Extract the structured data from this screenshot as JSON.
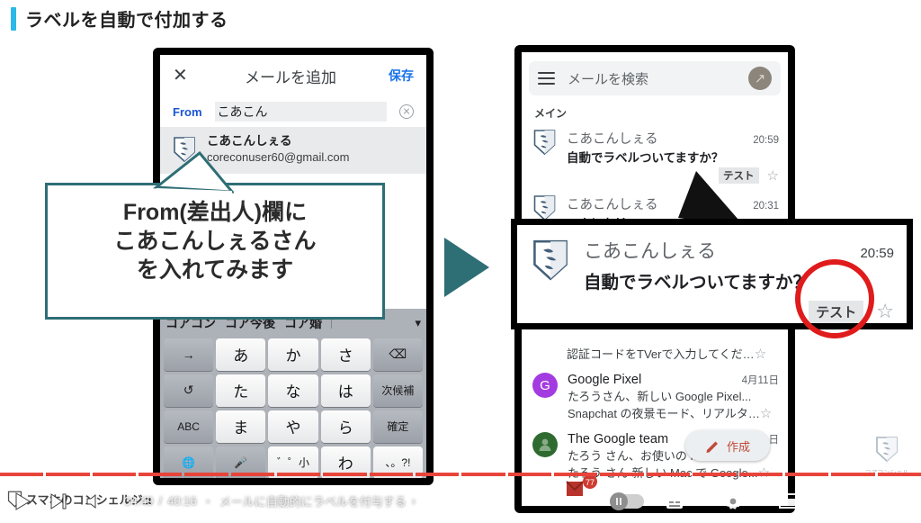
{
  "slide": {
    "title": "ラベルを自動で付加する",
    "accent_color": "#2bb9e8"
  },
  "callout_left": {
    "line1": "From(差出人)欄に",
    "line2": "こあこんしぇるさん",
    "line3": "を入れてみます",
    "border_color": "#2e6e75"
  },
  "phone_left": {
    "header": {
      "close_icon": "close-icon",
      "title": "メールを追加",
      "save_label": "保存",
      "save_color": "#1a73e8"
    },
    "from_field": {
      "label": "From",
      "value": "こあこん",
      "clear_icon": "clear-circle-icon"
    },
    "suggestion": {
      "name": "こあこんしぇる",
      "email": "coreconuser60@gmail.com",
      "avatar_icon": "koacon-shield-avatar"
    },
    "keyboard": {
      "candidates": [
        "コアコン",
        "コア今後",
        "コア婚"
      ],
      "expand_icon": "chevron-down-icon",
      "rows": [
        [
          {
            "label": "→",
            "type": "fn",
            "name": "cursor-right-key"
          },
          {
            "label": "あ",
            "type": "char",
            "name": "key-a"
          },
          {
            "label": "か",
            "type": "char",
            "name": "key-ka"
          },
          {
            "label": "さ",
            "type": "char",
            "name": "key-sa"
          },
          {
            "label": "⌫",
            "type": "fn",
            "name": "backspace-key"
          }
        ],
        [
          {
            "label": "↺",
            "type": "fn",
            "name": "undo-key"
          },
          {
            "label": "た",
            "type": "char",
            "name": "key-ta"
          },
          {
            "label": "な",
            "type": "char",
            "name": "key-na"
          },
          {
            "label": "は",
            "type": "char",
            "name": "key-ha"
          },
          {
            "label": "次候補",
            "type": "fn",
            "name": "next-candidate-key"
          }
        ],
        [
          {
            "label": "ABC",
            "type": "fn",
            "name": "abc-key"
          },
          {
            "label": "ま",
            "type": "char",
            "name": "key-ma"
          },
          {
            "label": "や",
            "type": "char",
            "name": "key-ya"
          },
          {
            "label": "ら",
            "type": "char",
            "name": "key-ra"
          },
          {
            "label": "確定",
            "type": "fn",
            "name": "confirm-key"
          }
        ],
        [
          {
            "label": "🌐",
            "type": "fn",
            "name": "globe-key"
          },
          {
            "label": "🎤",
            "type": "fn",
            "name": "mic-key"
          },
          {
            "label": "゛゜小",
            "type": "char",
            "name": "dakuten-key"
          },
          {
            "label": "わ",
            "type": "char",
            "name": "key-wa"
          },
          {
            "label": "、。?!",
            "type": "char",
            "name": "punctuation-key"
          }
        ]
      ]
    }
  },
  "phone_right": {
    "search": {
      "menu_icon": "hamburger-menu-icon",
      "placeholder": "メールを検索",
      "avatar_icon": "account-avatar"
    },
    "section_label": "メイン",
    "emails": [
      {
        "avatar_type": "shield",
        "sender": "こあこんしぇる",
        "time": "20:59",
        "subject": "自動でラベルついてますか？",
        "snippet": "",
        "label_chip": "テスト",
        "star_icon": "star-outline-icon"
      },
      {
        "avatar_type": "shield",
        "sender": "こあこんしぇる",
        "time": "20:31",
        "subject": "こんにちは",
        "snippet": "",
        "label_chip": "",
        "star_icon": "star-outline-icon"
      },
      {
        "avatar_type": "none",
        "sender": "",
        "time": "",
        "subject": "",
        "snippet": "認証コードをTVerで入力してくだ…",
        "label_chip": "",
        "star_icon": "star-outline-icon"
      },
      {
        "avatar_type": "letter",
        "avatar_letter": "G",
        "avatar_color": "#a33ce0",
        "sender": "Google Pixel",
        "time": "4月11日",
        "subject": "たろうさん、新しい Google Pixel...",
        "snippet": "Snapchat の夜景モード、リアルタ…",
        "label_chip": "",
        "star_icon": "star-outline-icon"
      },
      {
        "avatar_type": "person",
        "avatar_color": "#2f6b30",
        "sender": "The Google team",
        "time": "日",
        "subject": "たろう さん、お使いの M...",
        "snippet": "たろう さん 新しい Mac で Google...",
        "label_chip": "",
        "star_icon": "star-outline-icon"
      }
    ],
    "compose_fab": {
      "icon": "pencil-icon",
      "label": "作成"
    },
    "mail_badge": {
      "icon": "mail-icon",
      "count": "77"
    }
  },
  "zoom_callout": {
    "sender": "こあこんしぇる",
    "time": "20:59",
    "subject": "自動でラベルついてますか？",
    "label_chip": "テスト",
    "star_icon": "star-outline-icon",
    "highlight_color": "#e01b1b",
    "avatar_icon": "koacon-shield-avatar"
  },
  "arrow": {
    "name": "transition-arrow",
    "color": "#2e6e75"
  },
  "watermark": {
    "logo_text": "コアコンシェル",
    "channel": "スマホのコンシェルジュ"
  },
  "player": {
    "play_icon": "play-icon",
    "next_icon": "next-track-icon",
    "volume_icon": "volume-icon",
    "current_time": "34:49",
    "separator": "/",
    "duration": "40:16",
    "dot": "・",
    "chapter": "メールに自動的にラベルを付与する",
    "chapter_chevron": "chevron-right-icon",
    "autoplay_icon": "autoplay-toggle",
    "subtitles_icon": "subtitles-icon",
    "settings_icon": "gear-icon",
    "miniplayer_icon": "miniplayer-icon",
    "theater_icon": "theater-mode-icon",
    "fullscreen_icon": "fullscreen-icon",
    "progress_color": "#e8443a"
  }
}
